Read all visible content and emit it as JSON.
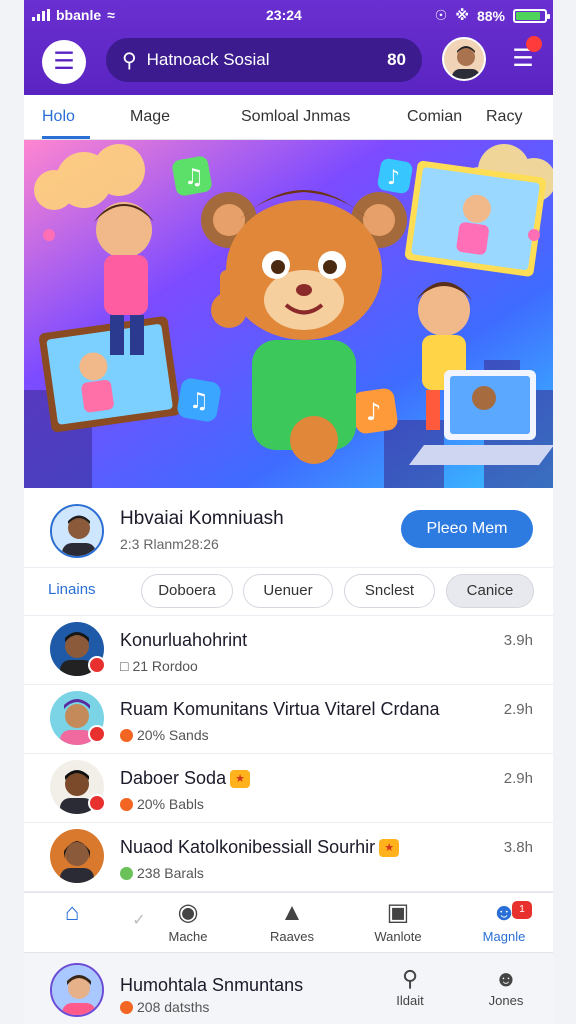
{
  "status": {
    "carrier": "bbanle",
    "time": "23:24",
    "battery": "88%"
  },
  "header": {
    "search_text": "Hatnoack Sosial",
    "search_count": "80",
    "notification_badge": ""
  },
  "tabs": [
    "Holo",
    "Mage",
    "Somloal Jnmas",
    "Comian",
    "Racy"
  ],
  "community": {
    "title": "Hbvaiai Komniuash",
    "subtitle": "2:3 Rlanm28:26",
    "join_label": "Pleeo Mem"
  },
  "chips": [
    "Linains",
    "Doboera",
    "Uenuer",
    "Snclest",
    "Canice"
  ],
  "feed": [
    {
      "title": "Konurluahohrint",
      "meta": "21 Rordoo",
      "time": "3.9h",
      "dot_color": "#ffffff"
    },
    {
      "title": "Ruam Komunitans Virtua Vitarel Crdana",
      "meta": "20% Sands",
      "time": "2.9h",
      "dot_color": "#f26522"
    },
    {
      "title": "Daboer Soda",
      "meta": "20% Babls",
      "time": "2.9h",
      "dot_color": "#f26522"
    },
    {
      "title": "Nuaod Katolkonibessiall Sourhir",
      "meta": "238 Barals",
      "time": "3.8h",
      "dot_color": "#6ac259"
    }
  ],
  "bottom_nav": [
    {
      "label": "",
      "icon": "home-icon"
    },
    {
      "label": "Mache",
      "icon": "pot-icon"
    },
    {
      "label": "Raaves",
      "icon": "map-icon"
    },
    {
      "label": "Wanlote",
      "icon": "box-icon"
    },
    {
      "label": "Magnle",
      "icon": "user-icon",
      "badge": "1"
    }
  ],
  "minibar": {
    "title": "Humohtala Snmuntans",
    "subtitle": "208 datsths",
    "action1_label": "Ildait",
    "action2_label": "Jones"
  },
  "colors": {
    "brand": "#5a24c2",
    "accent": "#2a6fd6",
    "join": "#2d7be0",
    "alert": "#e8302f"
  }
}
